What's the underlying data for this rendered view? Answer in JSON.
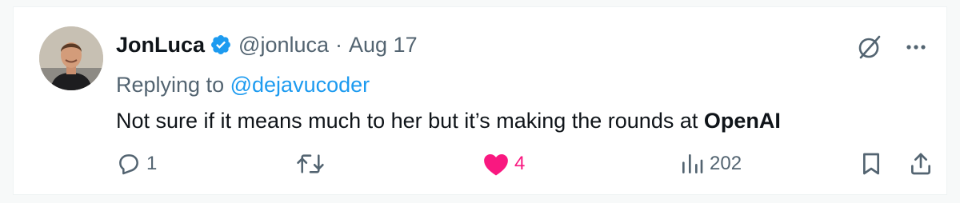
{
  "tweet": {
    "author": {
      "display_name": "JonLuca",
      "handle": "@jonluca",
      "verified": true,
      "avatar_icon": "avatar-photo"
    },
    "separator": "·",
    "date": "Aug 17",
    "replying_to_label": "Replying to",
    "replying_to_handle": "@dejavucoder",
    "text_plain": "Not sure if it means much to her but it’s making the rounds at ",
    "text_bold": "OpenAI",
    "actions": {
      "reply_count": "1",
      "retweet_count": "",
      "like_count": "4",
      "liked": true,
      "view_count": "202"
    },
    "icons": {
      "grok": "grok-slash-icon",
      "more": "more-dots-icon",
      "reply": "reply-icon",
      "retweet": "retweet-icon",
      "like": "heart-icon",
      "views": "views-icon",
      "bookmark": "bookmark-icon",
      "share": "share-icon"
    },
    "colors": {
      "accent": "#1d9bf0",
      "like": "#f91880",
      "muted": "#536471",
      "text": "#0f1419"
    }
  }
}
